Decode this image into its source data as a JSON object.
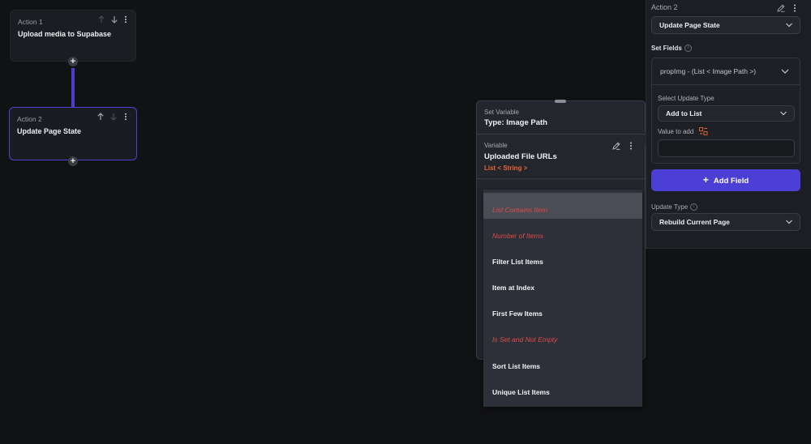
{
  "canvas": {
    "action1": {
      "caption": "Action 1",
      "title": "Upload media to Supabase"
    },
    "action2": {
      "caption": "Action 2",
      "title": "Update Page State"
    },
    "add_glyph": "+"
  },
  "popup": {
    "set_variable_label": "Set Variable",
    "type_label": "Type: Image Path",
    "variable_label": "Variable",
    "variable_name": "Uploaded File URLs",
    "variable_type": "List < String >"
  },
  "menu": {
    "items": [
      {
        "label": "List Contains Item",
        "style": "highlighted-red"
      },
      {
        "label": "Number of Items",
        "style": "red"
      },
      {
        "label": "Filter List Items",
        "style": "normal"
      },
      {
        "label": "Item at Index",
        "style": "normal"
      },
      {
        "label": "First Few Items",
        "style": "normal"
      },
      {
        "label": "Is Set and Not Empty",
        "style": "red"
      },
      {
        "label": "Sort List Items",
        "style": "normal"
      },
      {
        "label": "Unique List Items",
        "style": "normal"
      }
    ]
  },
  "panel": {
    "action_label": "Action 2",
    "action_select": "Update Page State",
    "set_fields_label": "Set Fields",
    "field_select": "propImg - (List < Image Path >)",
    "select_update_type_label": "Select Update Type",
    "update_type_select": "Add to List",
    "value_to_add_label": "Value to add",
    "add_field_button": "Add Field",
    "add_field_plus": "+",
    "update_type_label": "Update Type",
    "rebuild_select": "Rebuild Current Page"
  },
  "colors": {
    "accent": "#4b3fd6",
    "danger_text": "#e04a4a",
    "orange_type": "#e8643a"
  }
}
